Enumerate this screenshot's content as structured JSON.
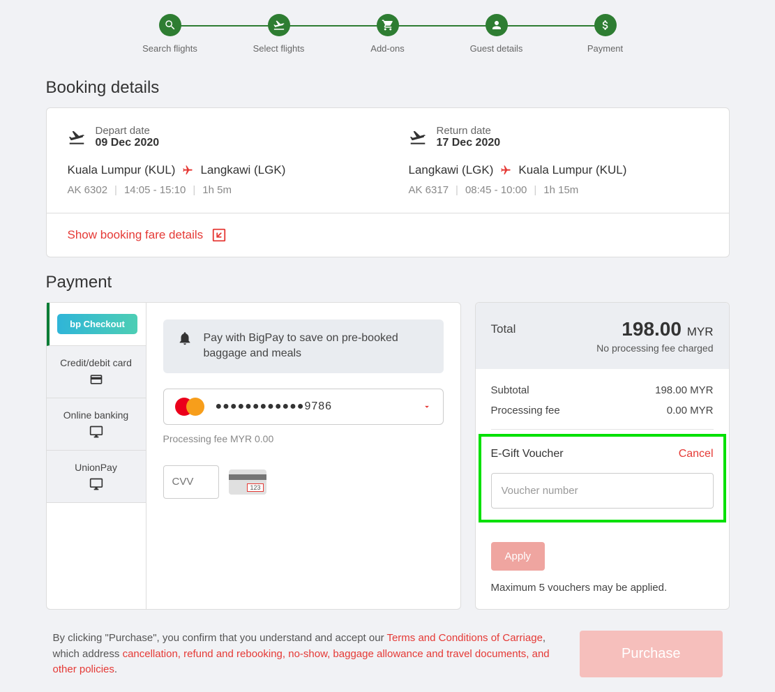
{
  "stepper": {
    "steps": [
      {
        "label": "Search flights",
        "icon": "search"
      },
      {
        "label": "Select flights",
        "icon": "takeoff"
      },
      {
        "label": "Add-ons",
        "icon": "cart"
      },
      {
        "label": "Guest details",
        "icon": "person"
      },
      {
        "label": "Payment",
        "icon": "dollar"
      }
    ]
  },
  "booking": {
    "title": "Booking details",
    "depart": {
      "label": "Depart date",
      "date": "09 Dec 2020",
      "from": "Kuala Lumpur (KUL)",
      "to": "Langkawi (LGK)",
      "flightNo": "AK 6302",
      "time": "14:05 - 15:10",
      "duration": "1h 5m"
    },
    "return": {
      "label": "Return date",
      "date": "17 Dec 2020",
      "from": "Langkawi (LGK)",
      "to": "Kuala Lumpur (KUL)",
      "flightNo": "AK 6317",
      "time": "08:45 - 10:00",
      "duration": "1h 15m"
    },
    "fareDetailsLink": "Show booking fare details"
  },
  "payment": {
    "title": "Payment",
    "methods": {
      "bigpay": "Checkout",
      "credit": "Credit/debit card",
      "online": "Online banking",
      "unionpay": "UnionPay"
    },
    "bigpayBanner": "Pay with BigPay to save on pre-booked baggage and meals",
    "cardMasked": "●●●●●●●●●●●●9786",
    "processingNote": "Processing fee MYR 0.00",
    "cvvPlaceholder": "CVV"
  },
  "summary": {
    "totalLabel": "Total",
    "totalValue": "198.00",
    "currency": "MYR",
    "noFeeNote": "No processing fee charged",
    "subtotal": {
      "label": "Subtotal",
      "value": "198.00 MYR"
    },
    "procFee": {
      "label": "Processing fee",
      "value": "0.00 MYR"
    },
    "voucher": {
      "title": "E-Gift Voucher",
      "cancel": "Cancel",
      "placeholder": "Voucher number",
      "apply": "Apply",
      "maxNote": "Maximum 5 vouchers may be applied."
    }
  },
  "footer": {
    "text1": "By clicking \"Purchase\", you confirm that you understand and accept our ",
    "link1": "Terms and Conditions of Carriage",
    "text2": ", which address ",
    "link2": "cancellation, refund and rebooking, no-show, baggage allowance and travel documents, and other policies",
    "text3": ".",
    "purchase": "Purchase"
  }
}
